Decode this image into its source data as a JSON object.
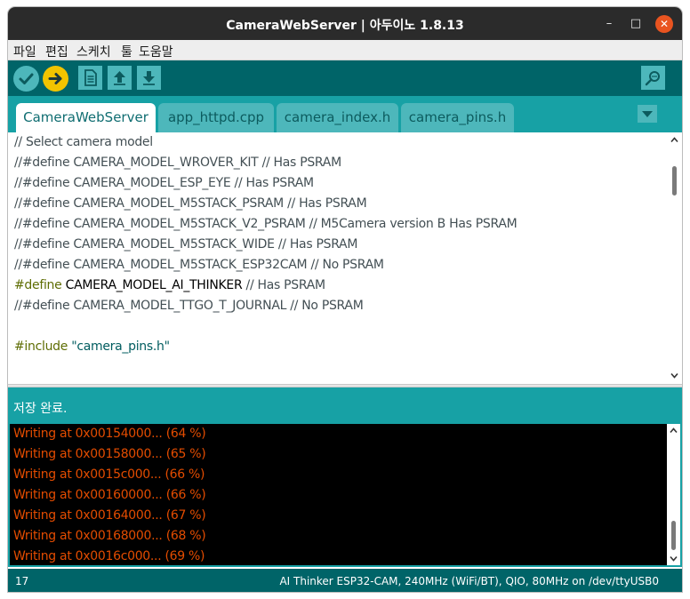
{
  "window": {
    "title": "CameraWebServer | 아두이노 1.8.13",
    "controls": {
      "minimize": "–",
      "maximize": "□",
      "close": "✕"
    }
  },
  "menubar": {
    "items": [
      {
        "label": "파일"
      },
      {
        "label": "편집"
      },
      {
        "label": "스케치"
      },
      {
        "label": "툴"
      },
      {
        "label": "도움말"
      }
    ]
  },
  "toolbar": {
    "buttons": [
      {
        "name": "verify",
        "icon": "check-icon"
      },
      {
        "name": "upload",
        "icon": "arrow-right-icon"
      },
      {
        "name": "new",
        "icon": "document-icon"
      },
      {
        "name": "open",
        "icon": "arrow-up-icon"
      },
      {
        "name": "save",
        "icon": "arrow-down-icon"
      },
      {
        "name": "serial-monitor",
        "icon": "magnifier-icon"
      }
    ]
  },
  "tabs": [
    {
      "label": "CameraWebServer",
      "active": true
    },
    {
      "label": "app_httpd.cpp",
      "active": false
    },
    {
      "label": "camera_index.h",
      "active": false
    },
    {
      "label": "camera_pins.h",
      "active": false
    }
  ],
  "editor": {
    "lines": [
      "// Select camera model",
      "//#define CAMERA_MODEL_WROVER_KIT // Has PSRAM",
      "//#define CAMERA_MODEL_ESP_EYE // Has PSRAM",
      "//#define CAMERA_MODEL_M5STACK_PSRAM // Has PSRAM",
      "//#define CAMERA_MODEL_M5STACK_V2_PSRAM // M5Camera version B Has PSRAM",
      "//#define CAMERA_MODEL_M5STACK_WIDE // Has PSRAM",
      "//#define CAMERA_MODEL_M5STACK_ESP32CAM // No PSRAM"
    ],
    "define_line": {
      "keyword": "#define",
      "name": " CAMERA_MODEL_AI_THINKER",
      "comment": " // Has PSRAM"
    },
    "ttgo_line": "//#define CAMERA_MODEL_TTGO_T_JOURNAL // No PSRAM",
    "include_line": {
      "keyword": "#include",
      "value": " \"camera_pins.h\""
    }
  },
  "status": {
    "message": "저장 완료."
  },
  "console": {
    "lines": [
      "Writing at 0x00154000... (64 %)",
      "Writing at 0x00158000... (65 %)",
      "Writing at 0x0015c000... (66 %)",
      "Writing at 0x00160000... (66 %)",
      "Writing at 0x00164000... (67 %)",
      "Writing at 0x00168000... (68 %)",
      "Writing at 0x0016c000... (69 %)"
    ]
  },
  "footer": {
    "line_number": "17",
    "board_info": "AI Thinker ESP32-CAM, 240MHz (WiFi/BT), QIO, 80MHz on /dev/ttyUSB0"
  },
  "colors": {
    "toolbar": "#006468",
    "tabbar": "#17a1a5",
    "button": "#4db7bb",
    "upload": "#f2c400",
    "console_text": "#e34c00",
    "close": "#e95420"
  }
}
